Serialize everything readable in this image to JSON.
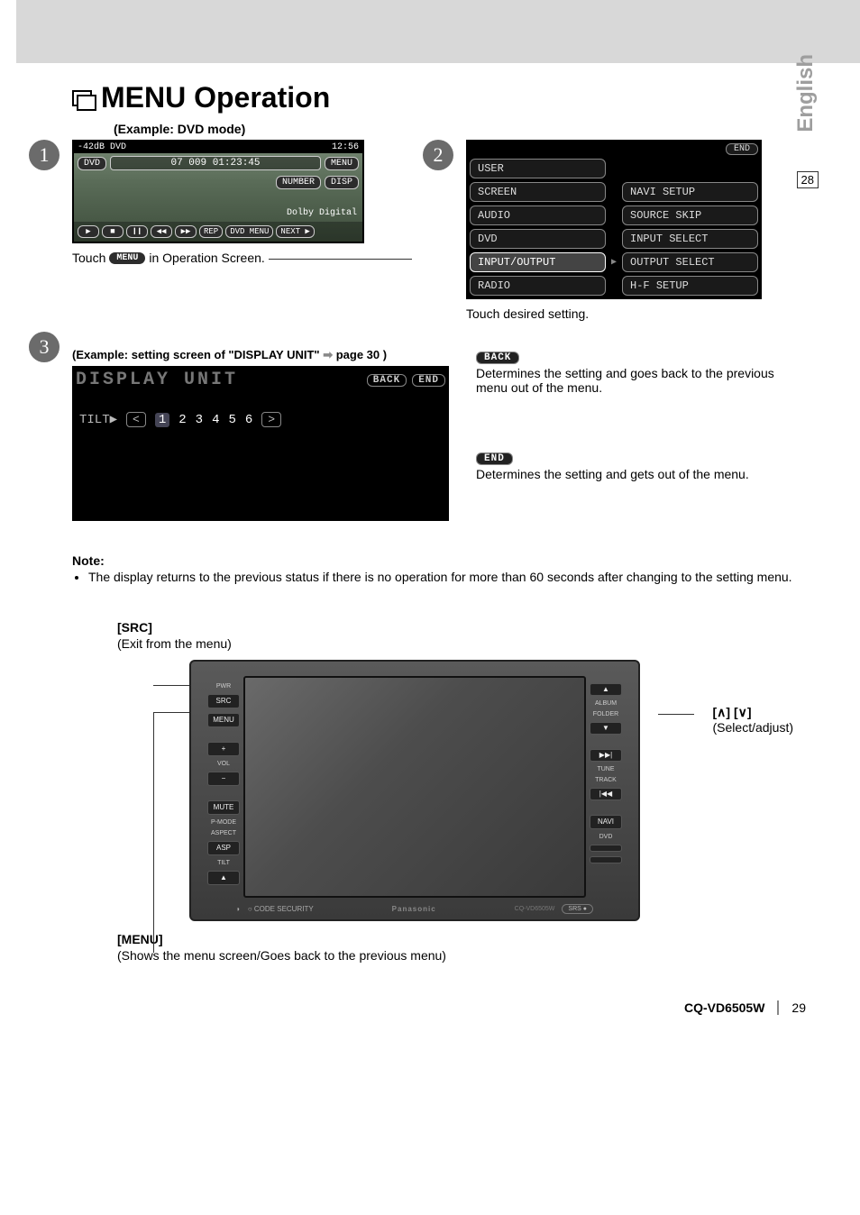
{
  "language_tab": "English",
  "page_box": "28",
  "title": "MENU Operation",
  "step1": {
    "example_label": "(Example: DVD mode)",
    "top_left": "-42dB  DVD",
    "top_right": "12:56",
    "dvd_label": "DVD",
    "info": "07  009 01:23:45",
    "menu_btn": "MENU",
    "number_btn": "NUMBER",
    "disp_btn": "DISP",
    "dolby": "Dolby Digital",
    "bottom_btns": [
      "▶",
      "■",
      "❙❙",
      "◀◀",
      "▶▶",
      "REP",
      "DVD\nMENU",
      "NEXT ▶"
    ],
    "caption_prefix": "Touch",
    "caption_btn": "MENU",
    "caption_suffix": "in Operation Screen."
  },
  "step2": {
    "end_btn": "END",
    "left_col": [
      "USER",
      "SCREEN",
      "AUDIO",
      "DVD",
      "INPUT/OUTPUT",
      "RADIO"
    ],
    "selected_index": 4,
    "right_col": [
      "NAVI SETUP",
      "SOURCE SKIP",
      "INPUT SELECT",
      "OUTPUT SELECT",
      "H-F SETUP"
    ],
    "caption": "Touch desired setting."
  },
  "step3": {
    "caption_prefix": "(Example: setting screen of \"DISPLAY UNIT\"",
    "caption_arrow": "➡",
    "caption_suffix": "page 30 )",
    "header": "DISPLAY UNIT",
    "back": "BACK",
    "end": "END",
    "tilt_label": "TILT▶",
    "tilt_values": [
      "1",
      "2",
      "3",
      "4",
      "5",
      "6"
    ],
    "active_tilt": 0,
    "back_pill": "BACK",
    "back_desc": "Determines the setting and goes back to the previous menu out of the menu.",
    "end_pill": "END",
    "end_desc": "Determines the setting and gets out of the menu."
  },
  "note": {
    "label": "Note:",
    "text": "The display returns to the previous status if there is no operation for more than 60 seconds after changing to the setting menu."
  },
  "unit": {
    "src_label": "[SRC]",
    "src_sub": "(Exit from the menu)",
    "menu_label": "[MENU]",
    "menu_sub": "(Shows the menu screen/Goes back to the previous menu)",
    "select_arrows": "[∧] [∨]",
    "select_sub": "(Select/adjust)",
    "left_buttons": {
      "pwr": "PWR",
      "src": "SRC",
      "menu": "MENU",
      "plus": "+",
      "vol": "VOL",
      "minus": "−",
      "mute": "MUTE",
      "pmode": "P-MODE",
      "aspect": "ASPECT",
      "asp": "ASP",
      "tilt": "TILT",
      "eject": "▲"
    },
    "right_buttons": {
      "up": "▲",
      "album": "ALBUM",
      "folder": "FOLDER",
      "down": "▼",
      "next": "▶▶|",
      "tune": "TUNE",
      "track": "TRACK",
      "prev": "|◀◀",
      "navi": "NAVI",
      "dvd": "DVD",
      "blank1": " ",
      "blank2": " "
    },
    "code_security": "○ CODE SECURITY",
    "brand": "Panasonic",
    "model": "CQ-VD6505W",
    "srs": "SRS ●"
  },
  "footer": {
    "model": "CQ-VD6505W",
    "page": "29"
  }
}
